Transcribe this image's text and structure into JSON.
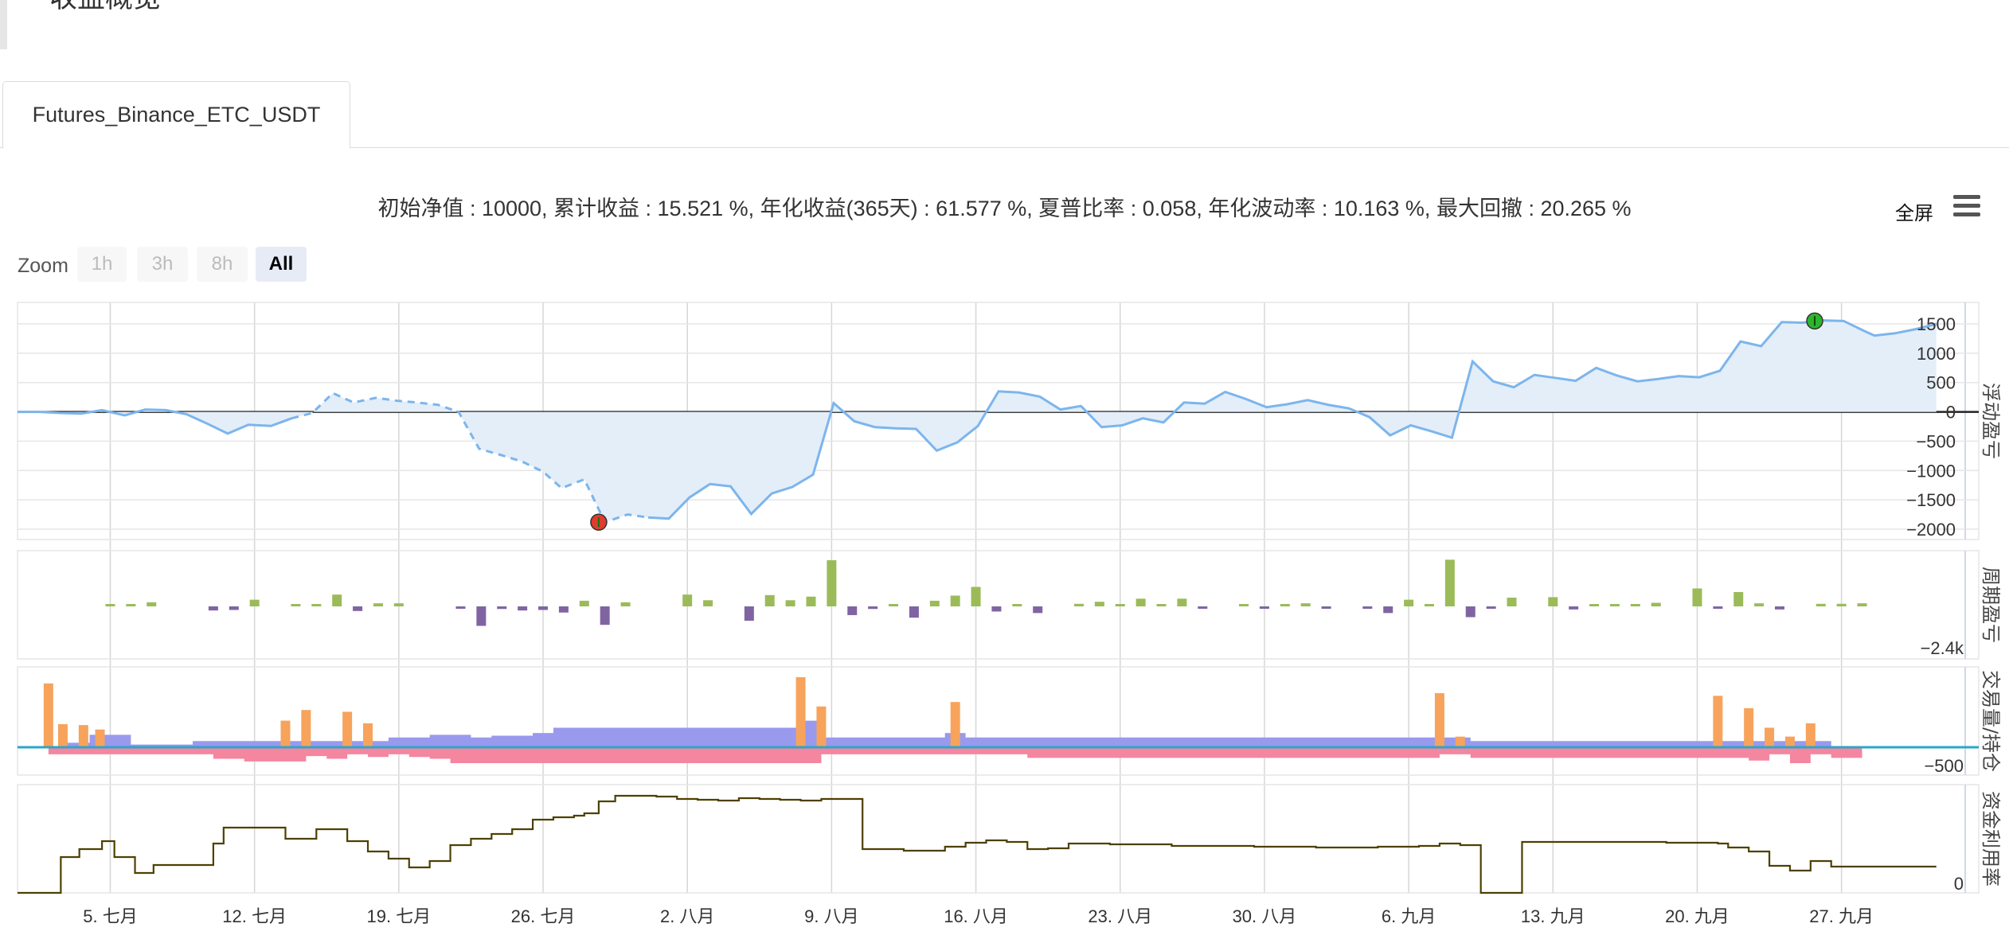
{
  "page": {
    "title": "收益概览"
  },
  "tab": {
    "label": "Futures_Binance_ETC_USDT"
  },
  "summary": {
    "text": "初始净值 : 10000, 累计收益 : 15.521 %, 年化收益(365天) : 61.577 %, 夏普比率 : 0.058, 年化波动率 : 10.163 %, 最大回撤 : 20.265 %"
  },
  "toolbar": {
    "fullscreen_label": "全屏",
    "menu_icon": "hamburger-menu-icon"
  },
  "zoom": {
    "label": "Zoom",
    "buttons": [
      {
        "label": "1h",
        "active": false
      },
      {
        "label": "3h",
        "active": false
      },
      {
        "label": "8h",
        "active": false
      },
      {
        "label": "All",
        "active": true
      }
    ]
  },
  "chart_data": {
    "type": "line",
    "x_tick_labels": [
      "5. 七月",
      "12. 七月",
      "19. 七月",
      "26. 七月",
      "2. 八月",
      "9. 八月",
      "16. 八月",
      "23. 八月",
      "30. 八月",
      "6. 九月",
      "13. 九月",
      "20. 九月",
      "27. 九月"
    ],
    "colors": {
      "profit_line": "#7cb5ec",
      "profit_fill": "#e3eef9",
      "bar_positive": "#9bbb59",
      "bar_negative": "#8064a2",
      "volume_orange": "#f7a35c",
      "position_blue": "#9999ee",
      "position_red": "#f4869f",
      "zero_line_teal": "#2aa7c9",
      "utilization_line": "#4d4000",
      "marker_green": "#2db52d",
      "marker_red": "#e03b2e"
    },
    "panels": [
      {
        "id": "floating_pnl",
        "ylabel": "浮动盈亏",
        "yticks": [
          1500,
          1000,
          500,
          0,
          -500,
          -1000,
          -1500,
          -2000
        ],
        "ylim": [
          -2100,
          1700
        ],
        "series": [
          {
            "type": "area",
            "dashed_segments": [
              [
                13,
                30
              ]
            ],
            "x": [
              0.0,
              1.1,
              2.1,
              3.1,
              4.1,
              5.2,
              6.2,
              7.2,
              8.2,
              9.2,
              10.2,
              11.2,
              12.3,
              13.3,
              14.3,
              15.3,
              16.3,
              17.4,
              18.4,
              19.4,
              20.4,
              21.4,
              22.4,
              23.5,
              24.5,
              25.5,
              26.4,
              27.5,
              28.5,
              29.6,
              30.6,
              31.6,
              32.6,
              33.6,
              34.6,
              35.6,
              36.6,
              37.6,
              38.6,
              39.6,
              40.6,
              41.6,
              42.6,
              43.6,
              44.6,
              45.6,
              46.6,
              47.6,
              48.6,
              49.6,
              50.6,
              51.6,
              52.6,
              53.6,
              54.6,
              55.6,
              56.6,
              57.6,
              58.6,
              59.6,
              60.6,
              61.6,
              62.6,
              63.6,
              64.6,
              65.6,
              66.6,
              67.6,
              68.6,
              69.6,
              70.6,
              71.6,
              72.6,
              73.6,
              74.6,
              75.6,
              76.6,
              77.6,
              78.6,
              79.6,
              80.6,
              81.6,
              82.6,
              83.6,
              84.6,
              85.6,
              86.6,
              87.6,
              88.6,
              89.6,
              90.1,
              91.1,
              92.1,
              93.1
            ],
            "y": [
              0,
              0,
              -20,
              -30,
              30,
              -60,
              40,
              30,
              -40,
              -200,
              -370,
              -220,
              -240,
              -110,
              -20,
              320,
              160,
              240,
              190,
              160,
              120,
              0,
              -630,
              -740,
              -850,
              -1020,
              -1300,
              -1150,
              -1880,
              -1750,
              -1800,
              -1820,
              -1460,
              -1230,
              -1270,
              -1740,
              -1390,
              -1280,
              -1070,
              150,
              -160,
              -260,
              -280,
              -290,
              -660,
              -520,
              -240,
              350,
              330,
              260,
              40,
              100,
              -260,
              -230,
              -110,
              -180,
              160,
              140,
              340,
              220,
              80,
              130,
              200,
              120,
              60,
              -90,
              -400,
              -230,
              -330,
              -440,
              860,
              520,
              420,
              630,
              580,
              530,
              750,
              620,
              520,
              560,
              610,
              590,
              700,
              1200,
              1120,
              1530,
              1520,
              1560,
              1550,
              1380,
              1300,
              1340,
              1410,
              1500
            ]
          }
        ],
        "markers": [
          {
            "x": 28.2,
            "y": -1880,
            "color": "red"
          },
          {
            "x": 87.2,
            "y": 1550,
            "color": "green"
          }
        ]
      },
      {
        "id": "period_pnl",
        "ylabel": "周期盈亏",
        "yticks_labels": [
          "-2.4k"
        ],
        "ylim": [
          -2400,
          2400
        ],
        "series": [
          {
            "type": "column",
            "x": [
              4,
              5,
              6,
              9,
              10,
              11,
              13,
              14,
              15,
              16,
              17,
              18,
              21,
              22,
              23,
              24,
              25,
              26,
              27,
              28,
              29,
              32,
              33,
              35,
              36,
              37,
              38,
              39,
              40,
              41,
              42,
              43,
              44,
              45,
              46,
              47,
              48,
              49,
              51,
              52,
              53,
              54,
              55,
              56,
              57,
              59,
              60,
              61,
              62,
              63,
              65,
              66,
              67,
              68,
              69,
              70,
              71,
              72,
              74,
              75,
              76,
              77,
              78,
              79,
              81,
              82,
              83,
              84,
              85,
              87,
              88,
              89
            ],
            "y": [
              40,
              30,
              80,
              -80,
              -70,
              130,
              30,
              40,
              230,
              -90,
              60,
              60,
              -30,
              -380,
              -50,
              -80,
              -70,
              -120,
              110,
              -360,
              80,
              230,
              120,
              -280,
              220,
              120,
              190,
              900,
              -170,
              -50,
              40,
              -220,
              110,
              210,
              380,
              -100,
              30,
              -130,
              50,
              90,
              40,
              150,
              30,
              150,
              -40,
              30,
              -40,
              40,
              60,
              -30,
              -40,
              -130,
              130,
              40,
              910,
              -210,
              -40,
              170,
              180,
              -60,
              40,
              40,
              40,
              70,
              350,
              -40,
              280,
              60,
              -60,
              50,
              50,
              60
            ]
          }
        ]
      },
      {
        "id": "volume_position",
        "ylabel": "交易量/持仓",
        "yticks_labels": [
          "-500"
        ],
        "series": [
          {
            "name": "volume",
            "type": "column",
            "color": "orange",
            "x": [
              1.5,
              2.2,
              3.2,
              4.0,
              13.0,
              14.0,
              16.0,
              17.0,
              38.0,
              39.0,
              45.5,
              69.0,
              70.0,
              82.5,
              84.0,
              85.0,
              86.0,
              87.0
            ],
            "y": [
              720,
              260,
              250,
              200,
              300,
              420,
              400,
              270,
              790,
              460,
              510,
              610,
              120,
              580,
              440,
              220,
              120,
              270
            ]
          },
          {
            "name": "long_position",
            "type": "step-area",
            "color": "blue",
            "x": [
              2.1,
              3.5,
              5.5,
              8.5,
              9.5,
              11.5,
              15.0,
              18.0,
              20.0,
              22.0,
              23.0,
              25.0,
              26.0,
              38.0,
              39.0,
              43.0,
              45.0,
              46.0,
              70.5,
              88.0
            ],
            "y": [
              50,
              140,
              30,
              70,
              70,
              70,
              70,
              110,
              140,
              110,
              130,
              160,
              220,
              300,
              110,
              110,
              160,
              110,
              70,
              70
            ]
          },
          {
            "name": "short_position",
            "type": "step-area",
            "color": "red",
            "x": [
              1.5,
              8.2,
              9.5,
              11.0,
              13.0,
              14.0,
              15.0,
              16.0,
              17.0,
              18.0,
              19.0,
              20.0,
              21.0,
              39.0,
              45.0,
              46.0,
              49.0,
              69.0,
              70.5,
              82.8,
              84.0,
              85.0,
              86.0,
              87.0,
              88.0,
              89.5
            ],
            "y": [
              -80,
              -80,
              -130,
              -160,
              -160,
              -100,
              -130,
              -80,
              -110,
              -80,
              -110,
              -130,
              -180,
              -80,
              -80,
              -80,
              -120,
              -80,
              -120,
              -120,
              -150,
              -80,
              -180,
              -80,
              -120,
              -120
            ]
          }
        ]
      },
      {
        "id": "capital_utilization",
        "ylabel": "资金利用率",
        "yticks_labels": [
          "0"
        ],
        "series": [
          {
            "type": "step",
            "color": "olive",
            "x": [
              0.0,
              2.1,
              3.0,
              4.1,
              4.7,
              5.7,
              6.6,
              7.5,
              9.5,
              10.0,
              13.0,
              14.5,
              16.0,
              17.0,
              18.0,
              19.0,
              20.0,
              21.0,
              22.0,
              23.0,
              24.0,
              25.0,
              26.0,
              27.0,
              27.5,
              28.2,
              29.0,
              31.0,
              32.0,
              33.0,
              34.0,
              35.0,
              36.0,
              37.0,
              38.0,
              39.0,
              41.0,
              43.0,
              45.0,
              46.0,
              47.0,
              48.0,
              49.0,
              50.0,
              51.0,
              53.0,
              56.0,
              60.0,
              63.0,
              66.0,
              68.0,
              69.0,
              70.0,
              71.0,
              73.0,
              80.0,
              81.0,
              82.5,
              83.0,
              84.0,
              85.0,
              86.0,
              87.0,
              88.0
            ],
            "y": [
              0,
              45,
              55,
              65,
              45,
              25,
              35,
              35,
              62,
              82,
              68,
              80,
              65,
              52,
              43,
              32,
              40,
              60,
              68,
              74,
              80,
              92,
              95,
              97,
              100,
              115,
              122,
              121,
              118,
              117,
              116,
              119,
              118,
              117,
              116,
              118,
              55,
              53,
              58,
              63,
              66,
              64,
              55,
              56,
              62,
              61,
              59,
              58,
              57,
              58,
              59,
              62,
              60,
              0,
              64,
              63,
              63,
              62,
              57,
              52,
              34,
              28,
              40,
              33
            ]
          }
        ]
      }
    ]
  }
}
